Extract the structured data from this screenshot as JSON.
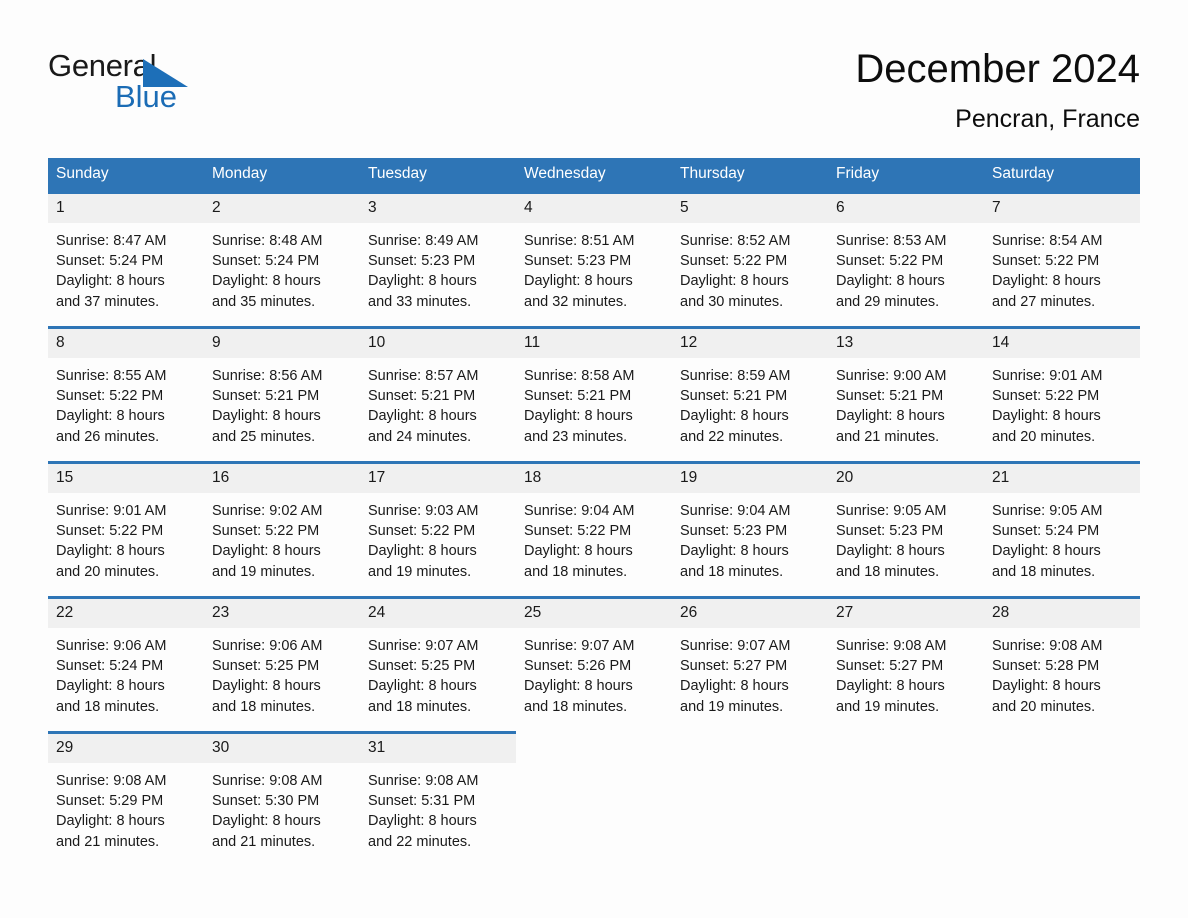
{
  "brand": {
    "name_part1": "General",
    "name_part2": "Blue",
    "triangle_color": "#1d6fb8"
  },
  "header": {
    "title": "December 2024",
    "location": "Pencran, France",
    "accent_color": "#2e75b6"
  },
  "calendar": {
    "weekday_headers": [
      "Sunday",
      "Monday",
      "Tuesday",
      "Wednesday",
      "Thursday",
      "Friday",
      "Saturday"
    ],
    "weeks": [
      [
        {
          "day": "1",
          "sunrise": "Sunrise: 8:47 AM",
          "sunset": "Sunset: 5:24 PM",
          "daylight1": "Daylight: 8 hours",
          "daylight2": "and 37 minutes."
        },
        {
          "day": "2",
          "sunrise": "Sunrise: 8:48 AM",
          "sunset": "Sunset: 5:24 PM",
          "daylight1": "Daylight: 8 hours",
          "daylight2": "and 35 minutes."
        },
        {
          "day": "3",
          "sunrise": "Sunrise: 8:49 AM",
          "sunset": "Sunset: 5:23 PM",
          "daylight1": "Daylight: 8 hours",
          "daylight2": "and 33 minutes."
        },
        {
          "day": "4",
          "sunrise": "Sunrise: 8:51 AM",
          "sunset": "Sunset: 5:23 PM",
          "daylight1": "Daylight: 8 hours",
          "daylight2": "and 32 minutes."
        },
        {
          "day": "5",
          "sunrise": "Sunrise: 8:52 AM",
          "sunset": "Sunset: 5:22 PM",
          "daylight1": "Daylight: 8 hours",
          "daylight2": "and 30 minutes."
        },
        {
          "day": "6",
          "sunrise": "Sunrise: 8:53 AM",
          "sunset": "Sunset: 5:22 PM",
          "daylight1": "Daylight: 8 hours",
          "daylight2": "and 29 minutes."
        },
        {
          "day": "7",
          "sunrise": "Sunrise: 8:54 AM",
          "sunset": "Sunset: 5:22 PM",
          "daylight1": "Daylight: 8 hours",
          "daylight2": "and 27 minutes."
        }
      ],
      [
        {
          "day": "8",
          "sunrise": "Sunrise: 8:55 AM",
          "sunset": "Sunset: 5:22 PM",
          "daylight1": "Daylight: 8 hours",
          "daylight2": "and 26 minutes."
        },
        {
          "day": "9",
          "sunrise": "Sunrise: 8:56 AM",
          "sunset": "Sunset: 5:21 PM",
          "daylight1": "Daylight: 8 hours",
          "daylight2": "and 25 minutes."
        },
        {
          "day": "10",
          "sunrise": "Sunrise: 8:57 AM",
          "sunset": "Sunset: 5:21 PM",
          "daylight1": "Daylight: 8 hours",
          "daylight2": "and 24 minutes."
        },
        {
          "day": "11",
          "sunrise": "Sunrise: 8:58 AM",
          "sunset": "Sunset: 5:21 PM",
          "daylight1": "Daylight: 8 hours",
          "daylight2": "and 23 minutes."
        },
        {
          "day": "12",
          "sunrise": "Sunrise: 8:59 AM",
          "sunset": "Sunset: 5:21 PM",
          "daylight1": "Daylight: 8 hours",
          "daylight2": "and 22 minutes."
        },
        {
          "day": "13",
          "sunrise": "Sunrise: 9:00 AM",
          "sunset": "Sunset: 5:21 PM",
          "daylight1": "Daylight: 8 hours",
          "daylight2": "and 21 minutes."
        },
        {
          "day": "14",
          "sunrise": "Sunrise: 9:01 AM",
          "sunset": "Sunset: 5:22 PM",
          "daylight1": "Daylight: 8 hours",
          "daylight2": "and 20 minutes."
        }
      ],
      [
        {
          "day": "15",
          "sunrise": "Sunrise: 9:01 AM",
          "sunset": "Sunset: 5:22 PM",
          "daylight1": "Daylight: 8 hours",
          "daylight2": "and 20 minutes."
        },
        {
          "day": "16",
          "sunrise": "Sunrise: 9:02 AM",
          "sunset": "Sunset: 5:22 PM",
          "daylight1": "Daylight: 8 hours",
          "daylight2": "and 19 minutes."
        },
        {
          "day": "17",
          "sunrise": "Sunrise: 9:03 AM",
          "sunset": "Sunset: 5:22 PM",
          "daylight1": "Daylight: 8 hours",
          "daylight2": "and 19 minutes."
        },
        {
          "day": "18",
          "sunrise": "Sunrise: 9:04 AM",
          "sunset": "Sunset: 5:22 PM",
          "daylight1": "Daylight: 8 hours",
          "daylight2": "and 18 minutes."
        },
        {
          "day": "19",
          "sunrise": "Sunrise: 9:04 AM",
          "sunset": "Sunset: 5:23 PM",
          "daylight1": "Daylight: 8 hours",
          "daylight2": "and 18 minutes."
        },
        {
          "day": "20",
          "sunrise": "Sunrise: 9:05 AM",
          "sunset": "Sunset: 5:23 PM",
          "daylight1": "Daylight: 8 hours",
          "daylight2": "and 18 minutes."
        },
        {
          "day": "21",
          "sunrise": "Sunrise: 9:05 AM",
          "sunset": "Sunset: 5:24 PM",
          "daylight1": "Daylight: 8 hours",
          "daylight2": "and 18 minutes."
        }
      ],
      [
        {
          "day": "22",
          "sunrise": "Sunrise: 9:06 AM",
          "sunset": "Sunset: 5:24 PM",
          "daylight1": "Daylight: 8 hours",
          "daylight2": "and 18 minutes."
        },
        {
          "day": "23",
          "sunrise": "Sunrise: 9:06 AM",
          "sunset": "Sunset: 5:25 PM",
          "daylight1": "Daylight: 8 hours",
          "daylight2": "and 18 minutes."
        },
        {
          "day": "24",
          "sunrise": "Sunrise: 9:07 AM",
          "sunset": "Sunset: 5:25 PM",
          "daylight1": "Daylight: 8 hours",
          "daylight2": "and 18 minutes."
        },
        {
          "day": "25",
          "sunrise": "Sunrise: 9:07 AM",
          "sunset": "Sunset: 5:26 PM",
          "daylight1": "Daylight: 8 hours",
          "daylight2": "and 18 minutes."
        },
        {
          "day": "26",
          "sunrise": "Sunrise: 9:07 AM",
          "sunset": "Sunset: 5:27 PM",
          "daylight1": "Daylight: 8 hours",
          "daylight2": "and 19 minutes."
        },
        {
          "day": "27",
          "sunrise": "Sunrise: 9:08 AM",
          "sunset": "Sunset: 5:27 PM",
          "daylight1": "Daylight: 8 hours",
          "daylight2": "and 19 minutes."
        },
        {
          "day": "28",
          "sunrise": "Sunrise: 9:08 AM",
          "sunset": "Sunset: 5:28 PM",
          "daylight1": "Daylight: 8 hours",
          "daylight2": "and 20 minutes."
        }
      ],
      [
        {
          "day": "29",
          "sunrise": "Sunrise: 9:08 AM",
          "sunset": "Sunset: 5:29 PM",
          "daylight1": "Daylight: 8 hours",
          "daylight2": "and 21 minutes."
        },
        {
          "day": "30",
          "sunrise": "Sunrise: 9:08 AM",
          "sunset": "Sunset: 5:30 PM",
          "daylight1": "Daylight: 8 hours",
          "daylight2": "and 21 minutes."
        },
        {
          "day": "31",
          "sunrise": "Sunrise: 9:08 AM",
          "sunset": "Sunset: 5:31 PM",
          "daylight1": "Daylight: 8 hours",
          "daylight2": "and 22 minutes."
        },
        {
          "day": "",
          "sunrise": "",
          "sunset": "",
          "daylight1": "",
          "daylight2": ""
        },
        {
          "day": "",
          "sunrise": "",
          "sunset": "",
          "daylight1": "",
          "daylight2": ""
        },
        {
          "day": "",
          "sunrise": "",
          "sunset": "",
          "daylight1": "",
          "daylight2": ""
        },
        {
          "day": "",
          "sunrise": "",
          "sunset": "",
          "daylight1": "",
          "daylight2": ""
        }
      ]
    ]
  }
}
